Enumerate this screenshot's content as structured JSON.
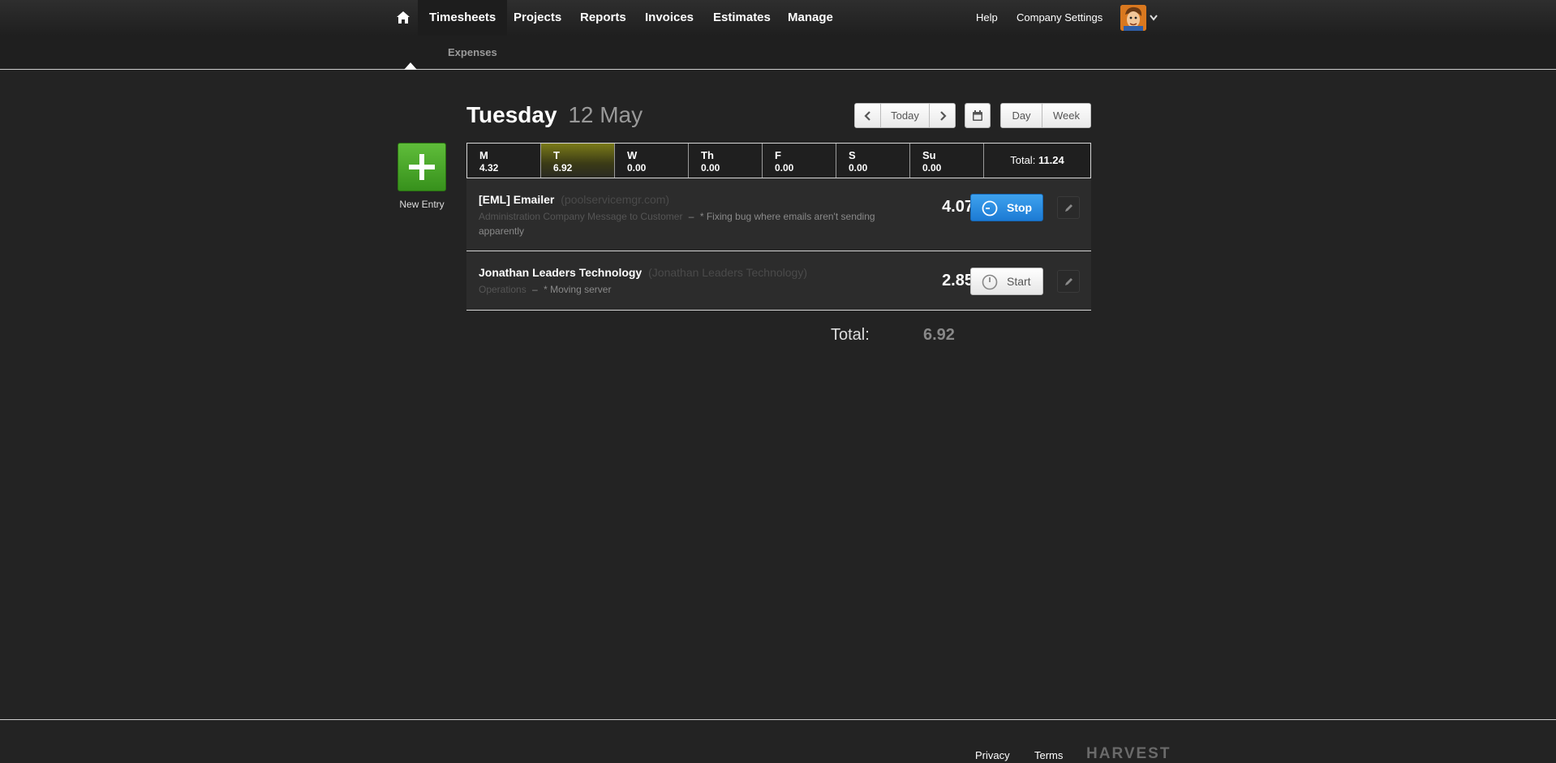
{
  "header": {
    "nav": [
      {
        "label": "Timesheets",
        "active": true
      },
      {
        "label": "Projects"
      },
      {
        "label": "Reports"
      },
      {
        "label": "Invoices"
      },
      {
        "label": "Estimates"
      },
      {
        "label": "Manage"
      }
    ],
    "help_label": "Help",
    "company_settings_label": "Company Settings",
    "home_icon": "home-icon",
    "avatar_icon": "avatar"
  },
  "subnav": {
    "expenses_label": "Expenses"
  },
  "sidebar": {
    "new_entry_label": "New Entry"
  },
  "date_header": {
    "day": "Tuesday",
    "date": "12 May"
  },
  "controls": {
    "today_label": "Today",
    "day_label": "Day",
    "week_label": "Week",
    "icons": {
      "prev": "chevron-left-icon",
      "next": "chevron-right-icon",
      "calendar": "calendar-icon"
    }
  },
  "week": {
    "days": [
      {
        "label": "M",
        "value": "4.32"
      },
      {
        "label": "T",
        "value": "6.92",
        "selected": true
      },
      {
        "label": "W",
        "value": "0.00"
      },
      {
        "label": "Th",
        "value": "0.00"
      },
      {
        "label": "F",
        "value": "0.00"
      },
      {
        "label": "S",
        "value": "0.00"
      },
      {
        "label": "Su",
        "value": "0.00"
      }
    ],
    "total_label": "Total:",
    "total_value": "11.24"
  },
  "entries": [
    {
      "project": "[EML] Emailer",
      "client": "(poolservicemgr.com)",
      "task": "Administration Company Message to Customer",
      "separator": "–",
      "notes": "* Fixing bug where emails aren't sending apparently",
      "hours": "4.07",
      "timer_label": "Stop",
      "running": true
    },
    {
      "project": "Jonathan Leaders Technology",
      "client": "(Jonathan Leaders Technology)",
      "task": "Operations",
      "separator": "–",
      "notes": "* Moving server",
      "hours": "2.85",
      "timer_label": "Start",
      "running": false
    }
  ],
  "day_total": {
    "label": "Total:",
    "value": "6.92"
  },
  "footer": {
    "privacy_label": "Privacy",
    "terms_label": "Terms",
    "logo_text": "HARVEST"
  },
  "colors": {
    "background": "#232323",
    "new_entry_green": "#4caf2a",
    "stop_blue": "#2a8ae0",
    "selected_day": "#7a7a18"
  }
}
